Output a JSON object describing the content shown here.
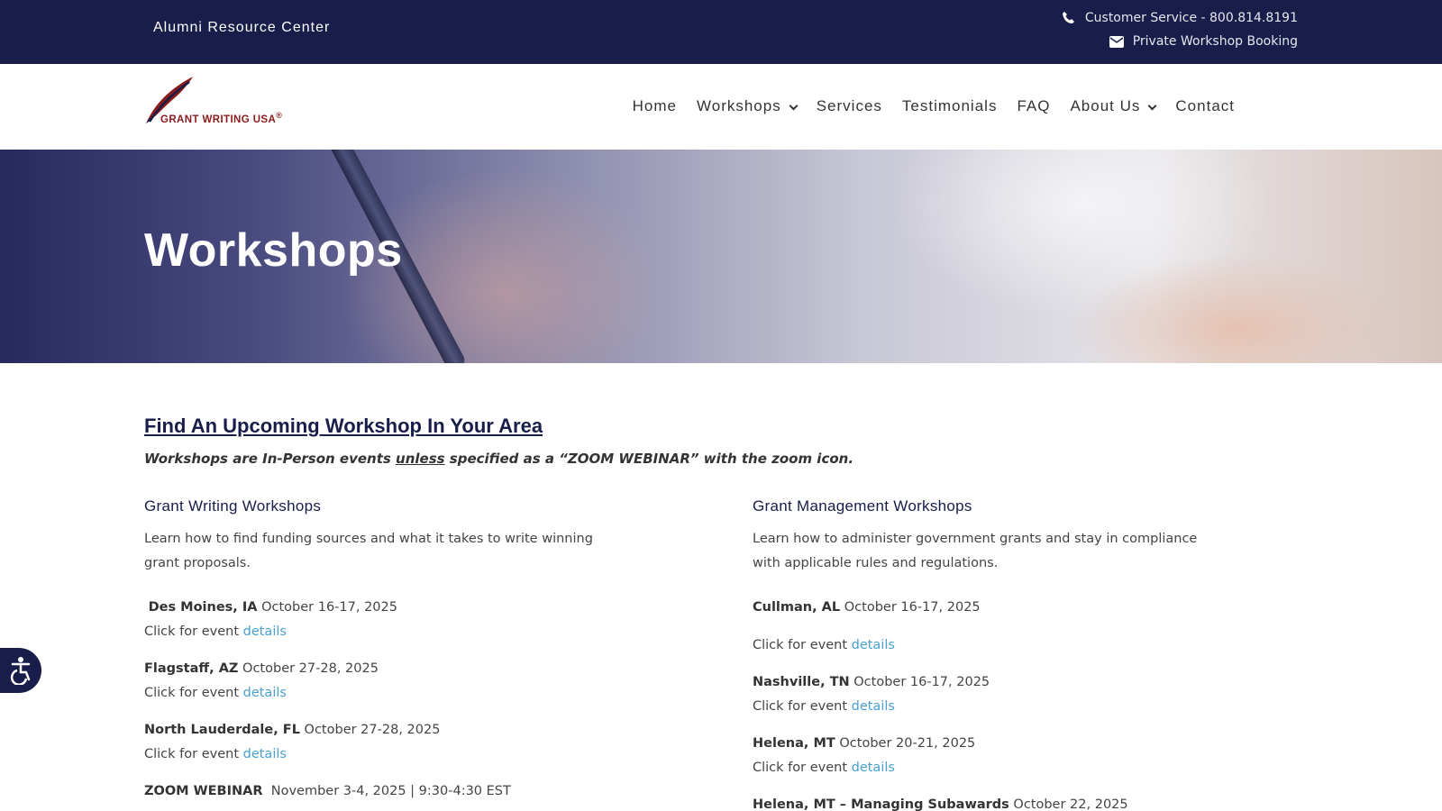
{
  "topbar": {
    "brand": "Alumni Resource Center",
    "phone": "Customer Service - 800.814.8191",
    "booking": "Private Workshop Booking",
    "phone_icon": "phone-icon",
    "mail_icon": "envelope-icon"
  },
  "logo": {
    "text": "GRANT WRITING USA",
    "mark": "®"
  },
  "nav": {
    "items": [
      {
        "label": "Home"
      },
      {
        "label": "Workshops"
      },
      {
        "label": "Services"
      },
      {
        "label": "Testimonials"
      },
      {
        "label": "FAQ"
      },
      {
        "label": "About Us"
      },
      {
        "label": "Contact"
      }
    ]
  },
  "hero": {
    "title": "Workshops"
  },
  "main": {
    "heading": "Find An Upcoming Workshop In Your Area",
    "note_pre": "Workshops are In-Person events ",
    "note_u": "unless",
    "note_post": " specified as a “ZOOM WEBINAR” with the zoom icon.",
    "left": {
      "title": "Grant Writing Workshops",
      "desc": "Learn how to find funding sources and what it takes to write winning grant proposals.",
      "events": [
        {
          "place": "Des Moines, IA",
          "date": "October 16-17, 2025",
          "cta": "Click for event ",
          "link": "details"
        },
        {
          "place": "Flagstaff, AZ",
          "date": "October 27-28, 2025",
          "cta": "Click for event ",
          "link": "details"
        },
        {
          "place": "North Lauderdale, FL",
          "date": "October 27-28, 2025",
          "cta": "Click for event ",
          "link": "details"
        },
        {
          "place": "ZOOM WEBINAR",
          "date": "November 3-4, 2025 | 9:30-4:30 EST"
        }
      ]
    },
    "right": {
      "title": "Grant Management Workshops",
      "desc": "Learn how to administer government grants and stay in compliance with applicable rules and regulations.",
      "events": [
        {
          "place": "Cullman, AL",
          "date": "October 16-17, 2025",
          "cta": "Click for event ",
          "link": "details"
        },
        {
          "place": "Nashville, TN",
          "date": "October 16-17, 2025",
          "cta": "Click for event ",
          "link": "details"
        },
        {
          "place": "Helena, MT",
          "date": "October 20-21, 2025",
          "cta": "Click for event ",
          "link": "details"
        },
        {
          "place": "Helena, MT – Managing Subawards",
          "date": "October 22, 2025"
        }
      ]
    }
  },
  "colors": {
    "navy": "#181d4a",
    "link": "#4aa0cf",
    "logo_red": "#8a1b1b"
  }
}
